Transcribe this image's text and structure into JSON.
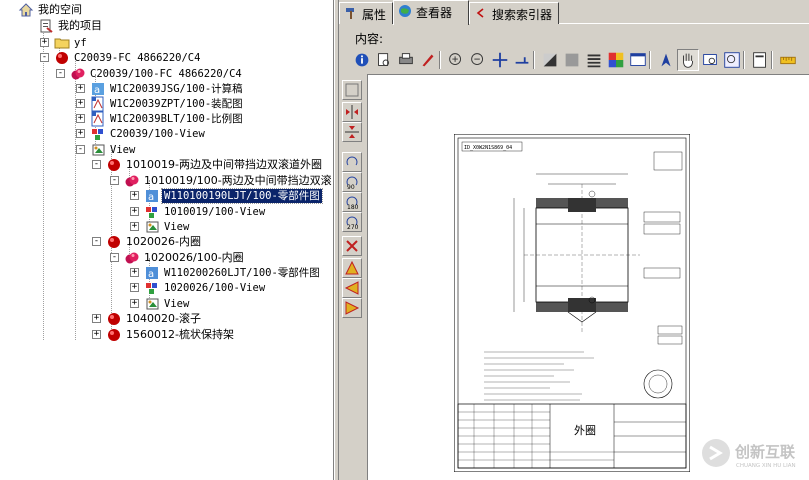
{
  "tree": {
    "rows": [
      {
        "label": "我的空间",
        "icon": "home-icon",
        "font": "sans"
      },
      {
        "label": "我的项目",
        "icon": "project-icon",
        "font": "sans"
      },
      {
        "label": "yf",
        "icon": "folder-icon",
        "font": "mono"
      },
      {
        "label": "C20039-FC 4866220/C4",
        "icon": "red-part-icon",
        "font": "mono"
      },
      {
        "label": "C20039/100-FC 4866220/C4",
        "icon": "red-version-icon",
        "font": "mono"
      },
      {
        "label": "W1C20039JSG/100-计算稿",
        "icon": "calc-doc-icon",
        "font": "mono"
      },
      {
        "label": "W1C20039ZPT/100-装配图",
        "icon": "drawing-doc-icon",
        "font": "mono"
      },
      {
        "label": "W1C20039BLT/100-比例图",
        "icon": "drawing-doc-icon",
        "font": "mono"
      },
      {
        "label": "C20039/100-View",
        "icon": "view-icon",
        "font": "mono"
      },
      {
        "label": "View",
        "icon": "camera-icon",
        "font": "mono"
      },
      {
        "label": "1010019-两边及中间带挡边双滚道外圈",
        "icon": "red-part-icon",
        "font": "sans"
      },
      {
        "label": "1010019/100-两边及中间带挡边双滚",
        "icon": "red-version-icon",
        "font": "sans"
      },
      {
        "label": "W110100190LJT/100-零部件图",
        "icon": "part-drawing-icon",
        "font": "mono"
      },
      {
        "label": "1010019/100-View",
        "icon": "view-icon",
        "font": "mono"
      },
      {
        "label": "View",
        "icon": "camera-icon",
        "font": "mono"
      },
      {
        "label": "1020026-内圈",
        "icon": "red-part-icon",
        "font": "sans"
      },
      {
        "label": "1020026/100-内圈",
        "icon": "red-version-icon",
        "font": "sans"
      },
      {
        "label": "W110200260LJT/100-零部件图",
        "icon": "part-drawing-icon",
        "font": "mono"
      },
      {
        "label": "1020026/100-View",
        "icon": "view-icon",
        "font": "mono"
      },
      {
        "label": "View",
        "icon": "camera-icon",
        "font": "mono"
      },
      {
        "label": "1040020-滚子",
        "icon": "red-part-icon",
        "font": "sans"
      },
      {
        "label": "1560012-梳状保持架",
        "icon": "red-part-icon",
        "font": "sans"
      }
    ]
  },
  "tabs": [
    {
      "label": "属性",
      "icon": "hammer-icon"
    },
    {
      "label": "查看器",
      "icon": "globe-icon"
    },
    {
      "label": "搜索索引器",
      "icon": "back-arrow-icon"
    }
  ],
  "content_label": "内容:",
  "toolbar_icons": [
    "info-icon",
    "print-preview-icon",
    "printer-icon",
    "pen-icon",
    "zoom-in-icon",
    "zoom-out-icon",
    "move-icon",
    "measure-icon",
    "contrast-icon",
    "gray-icon",
    "layers-icon",
    "color-icon",
    "window-icon",
    "pointer-icon",
    "hand-icon",
    "zoom-window-icon",
    "magnifier-icon",
    "page-icon",
    "ruler-icon"
  ],
  "side_icons": [
    "fit-icon",
    "flip-horizontal-icon",
    "flip-vertical-icon",
    "rotate-0-icon",
    "rotate-90-icon",
    "rotate-180-icon",
    "rotate-270-icon",
    "no-mirror-icon",
    "triangle-up-icon",
    "triangle-left-icon",
    "triangle-right-icon"
  ],
  "side_labels": {
    "r90": "90",
    "r180": "180",
    "r270": "270"
  },
  "drawing": {
    "title_block_name": "外圈",
    "stamp_text": "ID_X0W2N1S869_04"
  },
  "watermark": {
    "main": "创新互联",
    "sub": "CHUANG XIN HU LIAN"
  },
  "colors": {
    "selection": "#0a246a",
    "panel": "#d4d0c8",
    "tree_bg": "#ffffff"
  }
}
